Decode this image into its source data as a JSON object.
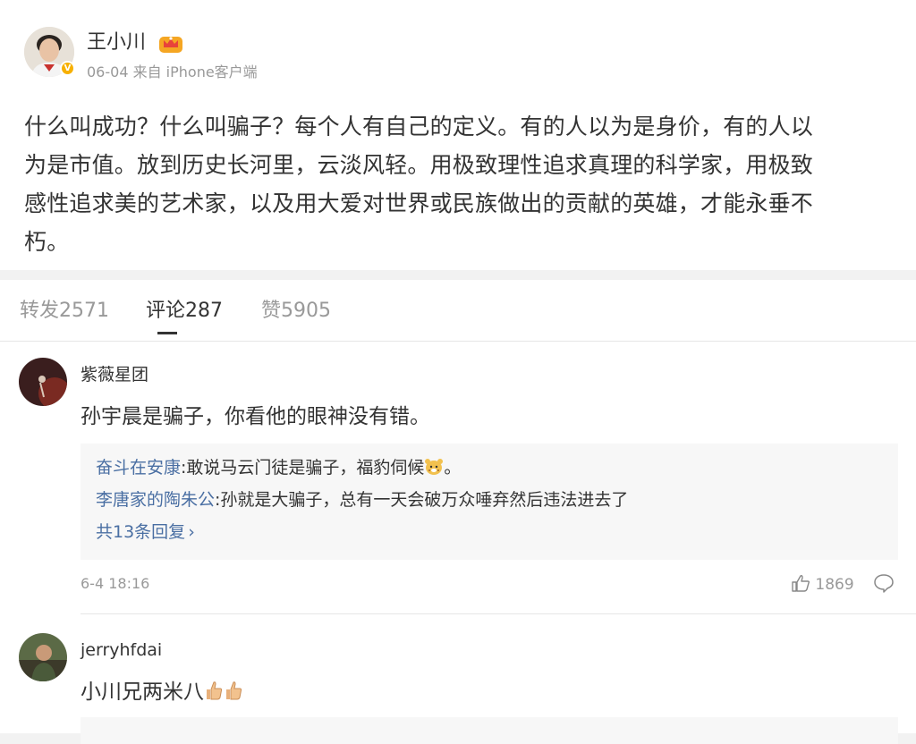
{
  "post": {
    "author": "王小川",
    "meta": "06-04 来自 iPhone客户端",
    "text_lines": [
      "什么叫成功？什么叫骗子？每个人有自己的定义。有的人以为是身价，有的人以",
      "为是市值。放到历史长河里，云淡风轻。用极致理性追求真理的科学家，用极致",
      "感性追求美的艺术家，以及用大爱对世界或民族做出的贡献的英雄，才能永垂不",
      "朽。"
    ]
  },
  "tabs": [
    {
      "label": "转发2571"
    },
    {
      "label": "评论287"
    },
    {
      "label": "赞5905"
    }
  ],
  "comments": [
    {
      "user": "紫薇星团",
      "text": "孙宇晨是骗子，你看他的眼神没有错。",
      "replies": [
        {
          "user": "奋斗在安康",
          "text": ":敢说马云门徒是骗子，福豹伺候",
          "tail": "。"
        },
        {
          "user": "李唐家的陶朱公",
          "text": ":孙就是大骗子，总有一天会破万众唾弃然后违法进去了"
        }
      ],
      "more_replies": "共13条回复",
      "time": "6-4 18:16",
      "likes": "1869"
    },
    {
      "user": "jerryhfdai",
      "text": "小川兄两米八"
    }
  ],
  "colors": {
    "link": "#4a6fa3",
    "muted": "#999999",
    "badge": "#f7b000"
  }
}
